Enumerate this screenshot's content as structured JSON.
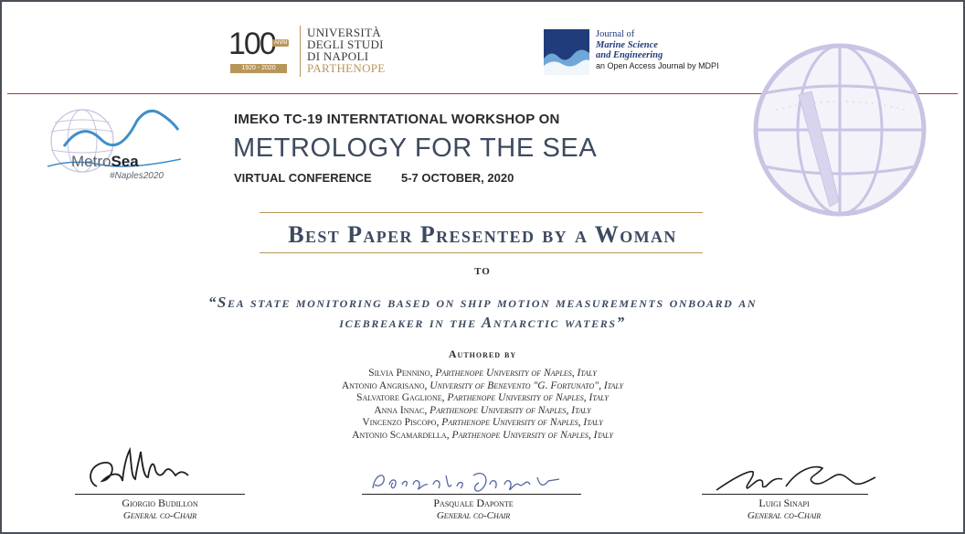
{
  "header": {
    "unina": {
      "hundred": "100",
      "anni": "ANNI",
      "years": "1920 - 2020",
      "lines": [
        "UNIVERSITÀ",
        "DEGLI STUDI",
        "DI NAPOLI"
      ],
      "parthenope": "PARTHENOPE"
    },
    "jmse": {
      "line1": "Journal of",
      "line2": "Marine Science",
      "line3": "and Engineering",
      "line4": "an Open Access Journal by MDPI"
    }
  },
  "logo": {
    "metro_light": "Metro",
    "metro_bold": "Sea",
    "tag": "#Naples2020"
  },
  "event": {
    "workshop": "IMEKO TC-19 INTERNTATIONAL WORKSHOP ON",
    "title": "METROLOGY FOR THE SEA",
    "virtual": "VIRTUAL CONFERENCE",
    "dates": "5-7 OCTOBER, 2020"
  },
  "award": {
    "title": "Best Paper Presented by a Woman",
    "to": "TO",
    "paper_line1": "“Sea state monitoring based on ship motion measurements onboard an",
    "paper_line2": "icebreaker in the Antarctic waters”",
    "authored_by": "Authored by"
  },
  "authors": [
    {
      "name": "Silvia Pennino, ",
      "affiliation": "Parthenope University of Naples, Italy"
    },
    {
      "name": "Antonio Angrisano, ",
      "affiliation": "University of Benevento \"G. Fortunato\", Italy"
    },
    {
      "name": "Salvatore Gaglione, ",
      "affiliation": "Parthenope University of Naples, Italy"
    },
    {
      "name": "Anna Innac, ",
      "affiliation": "Parthenope University of Naples, Italy"
    },
    {
      "name": "Vincenzo Piscopo, ",
      "affiliation": "Parthenope University of Naples, Italy"
    },
    {
      "name": "Antonio Scamardella, ",
      "affiliation": "Parthenope University of Naples, Italy"
    }
  ],
  "signatories": [
    {
      "name": "Giorgio Budillon",
      "role": "General co-Chair"
    },
    {
      "name": "Pasquale Daponte",
      "role": "General co-Chair"
    },
    {
      "name": "Luigi Sinapi",
      "role": "General co-Chair"
    }
  ],
  "colors": {
    "navy": "#3d4a60",
    "gold": "#b8965a",
    "rule": "#9b3a3a",
    "globe": "#c9c4e4"
  }
}
